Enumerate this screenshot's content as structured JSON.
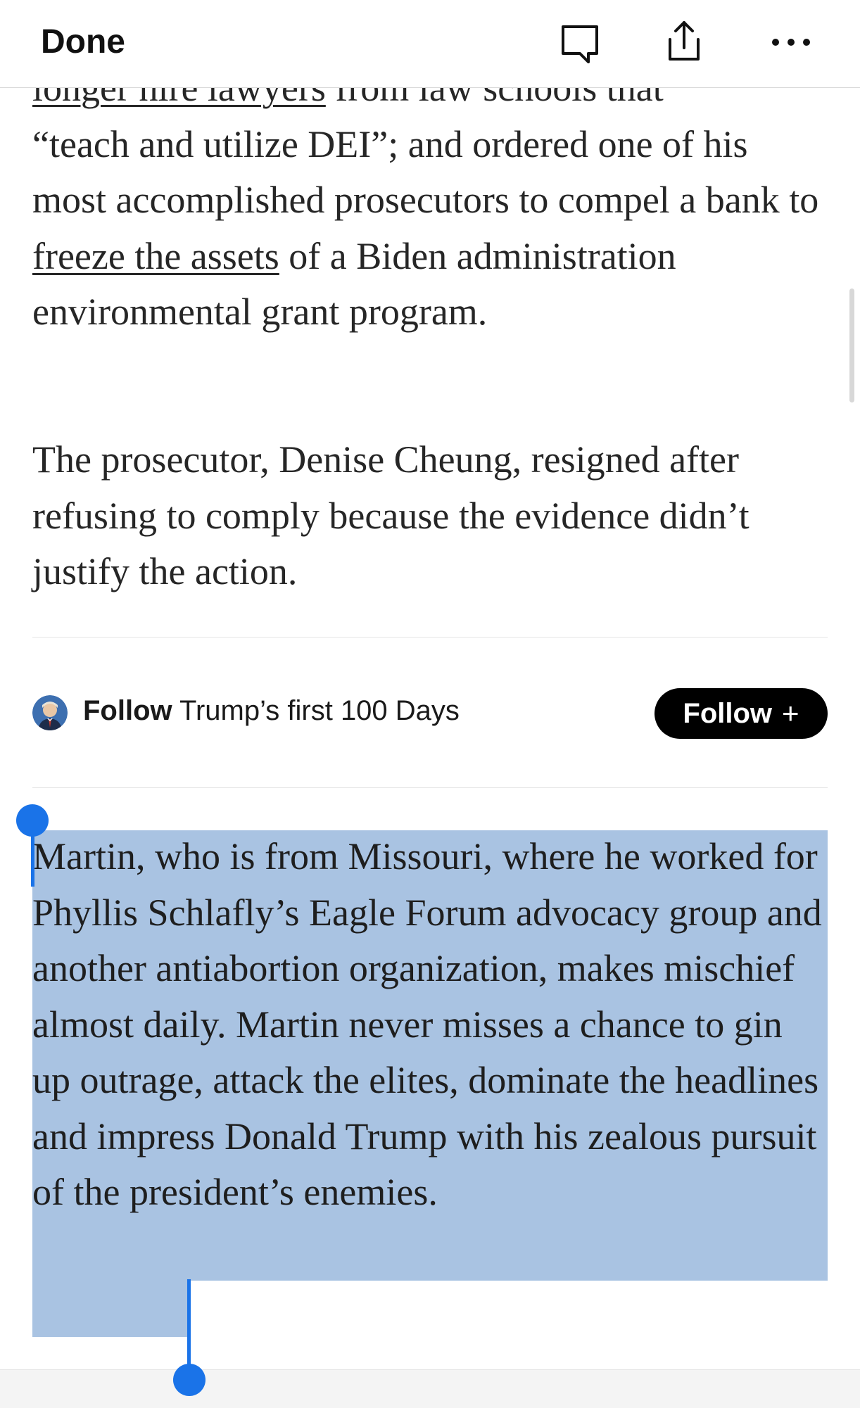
{
  "toolbar": {
    "done_label": "Done",
    "icons": [
      "comment-icon",
      "share-icon",
      "more-icon"
    ]
  },
  "article": {
    "para1": {
      "line0_link": "longer hire lawyers",
      "line0_rest": " from law schools that",
      "before_link": "“teach and utilize DEI”; and ordered one of his most accomplished prosecutors to compel a bank to ",
      "link_text": "freeze the assets",
      "after_link": " of a Biden administration environmental grant program."
    },
    "para2": "The prosecutor, Denise Cheung, resigned after refusing to comply because the evidence didn’t justify the action.",
    "follow": {
      "prefix": "Follow",
      "topic": "Trump’s first 100 Days",
      "button_label": "Follow",
      "button_plus": "+"
    },
    "para3": "Martin, who is from Missouri, where he worked for Phyllis Schlafly’s Eagle Forum advocacy group and another antiabortion organization, makes mischief almost daily. Martin never misses a chance to gin up outrage, attack the elites, dominate the headlines and impress Donald Trump with his zealous pursuit of the president’s enemies."
  },
  "colors": {
    "selection": "#a9c3e2",
    "selection_handle": "#1a73e8",
    "follow_button": "#000000"
  }
}
